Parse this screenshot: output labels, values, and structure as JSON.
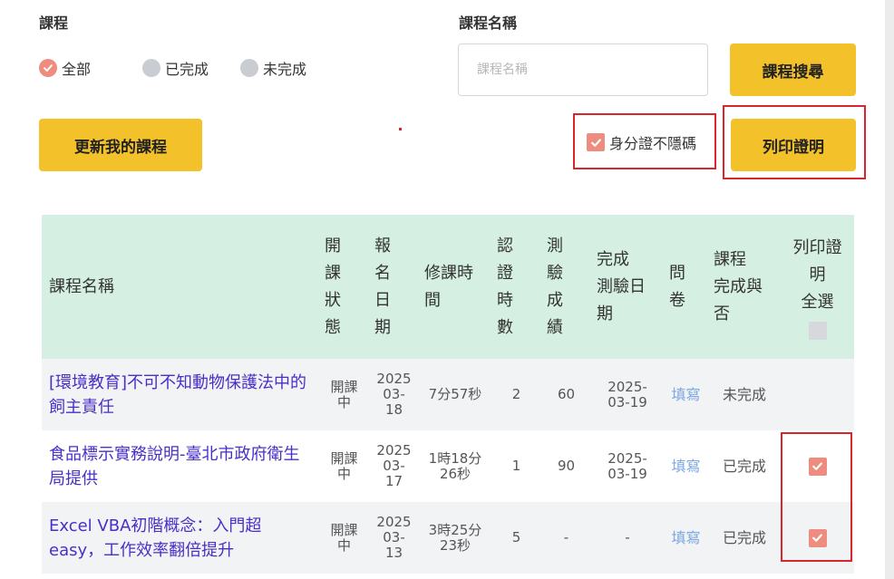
{
  "filters": {
    "course_label": "課程",
    "name_label": "課程名稱",
    "radios": [
      {
        "label": "全部",
        "selected": true
      },
      {
        "label": "已完成",
        "selected": false
      },
      {
        "label": "未完成",
        "selected": false
      }
    ],
    "search_placeholder": "課程名稱",
    "search_button": "課程搜尋"
  },
  "actions": {
    "update_button": "更新我的課程",
    "id_unmask_label": "身分證不隱碼",
    "id_unmask_checked": true,
    "print_button": "列印證明"
  },
  "colors": {
    "accent_button": "#f3c12a",
    "check": "#ee8c7f",
    "header_bg": "#d5f0e2",
    "link": "#4a2ec9",
    "highlight": "#d9262c"
  },
  "table": {
    "headers": {
      "name": "課程名稱",
      "open_status": [
        "開",
        "課",
        "狀",
        "態"
      ],
      "enroll_date": [
        "報",
        "名",
        "日",
        "期"
      ],
      "study_time": [
        "修課時",
        "間"
      ],
      "cert_hours": [
        "認",
        "證",
        "時",
        "數"
      ],
      "test_score": [
        "測",
        "驗",
        "成",
        "績"
      ],
      "test_date": [
        "完成",
        "測驗日",
        "期"
      ],
      "survey": [
        "問",
        "卷"
      ],
      "completion": [
        "課程",
        "完成與",
        "否"
      ],
      "print_all": [
        "列印證",
        "明",
        "全選"
      ]
    },
    "rows": [
      {
        "name": "[環境教育]不可不知動物保護法中的飼主責任",
        "open_status": [
          "開課",
          "中"
        ],
        "enroll_date": [
          "2025",
          "03-",
          "18"
        ],
        "study_time": [
          "7分57秒"
        ],
        "cert_hours": "2",
        "test_score": "60",
        "test_date": [
          "2025-",
          "03-19"
        ],
        "survey": "填寫",
        "completion": "未完成",
        "print_checked": false
      },
      {
        "name": "食品標示實務說明-臺北市政府衛生局提供",
        "open_status": [
          "開課",
          "中"
        ],
        "enroll_date": [
          "2025",
          "03-",
          "17"
        ],
        "study_time": [
          "1時18分",
          "26秒"
        ],
        "cert_hours": "1",
        "test_score": "90",
        "test_date": [
          "2025-",
          "03-19"
        ],
        "survey": "填寫",
        "completion": "已完成",
        "print_checked": true
      },
      {
        "name": "Excel VBA初階概念：入門超easy，工作效率翻倍提升",
        "open_status": [
          "開課",
          "中"
        ],
        "enroll_date": [
          "2025",
          "03-",
          "13"
        ],
        "study_time": [
          "3時25分",
          "23秒"
        ],
        "cert_hours": "5",
        "test_score": "-",
        "test_date": [
          "-"
        ],
        "survey": "填寫",
        "completion": "已完成",
        "print_checked": true
      }
    ]
  }
}
